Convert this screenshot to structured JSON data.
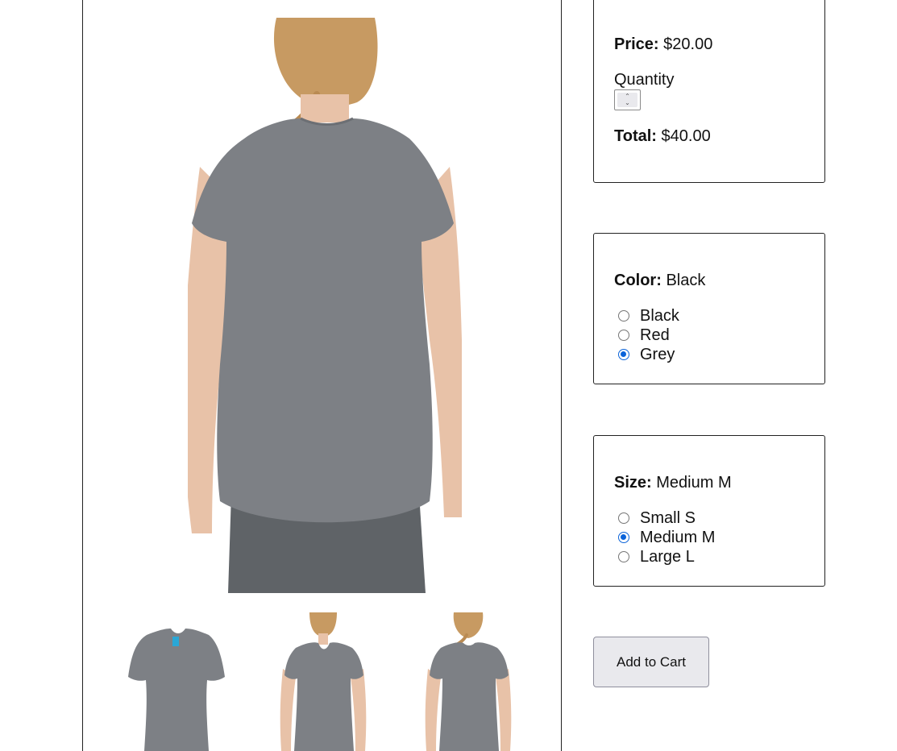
{
  "product": {
    "price_label": "Price:",
    "price_value": "$20.00",
    "quantity_label": "Quantity",
    "total_label": "Total:",
    "total_value": "$40.00"
  },
  "color": {
    "label": "Color:",
    "selected_text": "Black",
    "options": [
      "Black",
      "Red",
      "Grey"
    ],
    "checked_option": "Grey"
  },
  "size": {
    "label": "Size:",
    "selected_text": "Medium M",
    "options": [
      "Small S",
      "Medium M",
      "Large L"
    ],
    "checked_option": "Medium M"
  },
  "actions": {
    "add_to_cart": "Add to Cart"
  },
  "colors": {
    "shirt_grey": "#7d8085",
    "pants_grey": "#5f6367",
    "skin": "#e8c2a8",
    "hair": "#c79a62",
    "radio_checked": "#0b63d9",
    "button_bg": "#e9e9ed"
  },
  "icons": {
    "quantity_spinner": "up-down-arrows-icon",
    "radio_checked": "radio-checked-icon",
    "radio_unchecked": "radio-unchecked-icon"
  }
}
